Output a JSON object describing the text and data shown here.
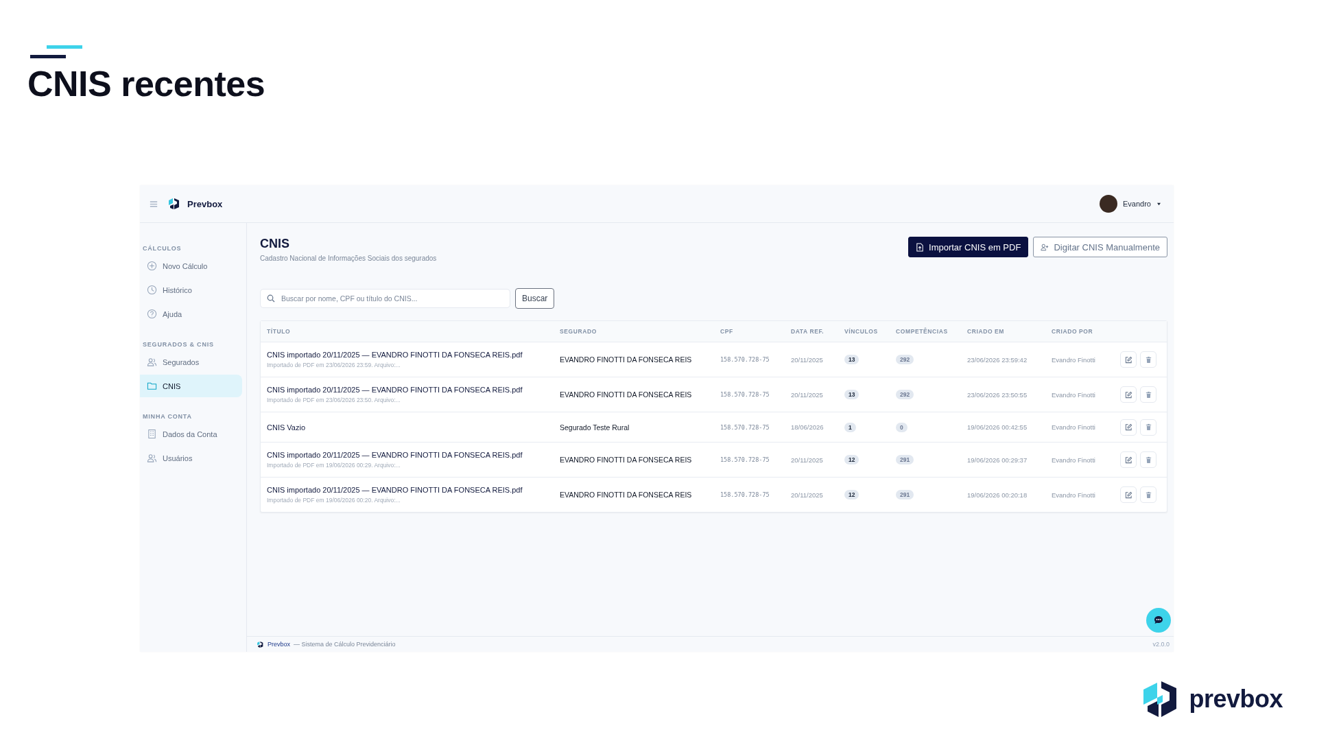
{
  "slide": {
    "title": "CNIS recentes",
    "logo": "prevbox"
  },
  "app": {
    "brand": "Prevbox",
    "user": "Evandro",
    "sidebar": [
      {
        "heading": "CÁLCULOS",
        "items": [
          {
            "label": "Novo Cálculo",
            "selected": false
          },
          {
            "label": "Histórico",
            "selected": false
          },
          {
            "label": "Ajuda",
            "selected": false
          }
        ]
      },
      {
        "heading": "SEGURADOS & CNIS",
        "items": [
          {
            "label": "Segurados",
            "selected": false
          },
          {
            "label": "CNIS",
            "selected": true
          }
        ]
      },
      {
        "heading": "MINHA CONTA",
        "items": [
          {
            "label": "Dados da Conta",
            "selected": false
          },
          {
            "label": "Usuários",
            "selected": false
          }
        ]
      }
    ],
    "page": {
      "title": "CNIS",
      "subtitle": "Cadastro Nacional de Informações Sociais dos segurados",
      "buttons": [
        {
          "label": "Importar CNIS em PDF",
          "kind": "primary"
        },
        {
          "label": "Digitar CNIS Manualmente",
          "kind": "outline"
        }
      ],
      "search": {
        "placeholder": "Buscar por nome, CPF ou título do CNIS...",
        "button": "Buscar"
      },
      "table": {
        "columns": [
          "TÍTULO",
          "SEGURADO",
          "CPF",
          "DATA REF.",
          "VÍNCULOS",
          "COMPETÊNCIAS",
          "CRIADO EM",
          "CRIADO POR"
        ],
        "rows": [
          {
            "title": "CNIS importado 20/11/2025 — EVANDRO FINOTTI DA FONSECA REIS.pdf",
            "note": "Importado de PDF em 23/06/2026 23:59. Arquivo:...",
            "insured": "EVANDRO FINOTTI DA FONSECA REIS",
            "cpf": "158.570.728-75",
            "ref_date": "20/11/2025",
            "links": "13",
            "periods": "292",
            "created_at": "23/06/2026 23:59:42",
            "created_by": "Evandro Finotti"
          },
          {
            "title": "CNIS importado 20/11/2025 — EVANDRO FINOTTI DA FONSECA REIS.pdf",
            "note": "Importado de PDF em 23/06/2026 23:50. Arquivo:...",
            "insured": "EVANDRO FINOTTI DA FONSECA REIS",
            "cpf": "158.570.728-75",
            "ref_date": "20/11/2025",
            "links": "13",
            "periods": "292",
            "created_at": "23/06/2026 23:50:55",
            "created_by": "Evandro Finotti"
          },
          {
            "title": "CNIS Vazio",
            "insured": "Segurado Teste Rural",
            "cpf": "158.570.728-75",
            "ref_date": "18/06/2026",
            "links": "1",
            "periods": "0",
            "created_at": "19/06/2026 00:42:55",
            "created_by": "Evandro Finotti"
          },
          {
            "title": "CNIS importado 20/11/2025 — EVANDRO FINOTTI DA FONSECA REIS.pdf",
            "note": "Importado de PDF em 19/06/2026 00:29. Arquivo:...",
            "insured": "EVANDRO FINOTTI DA FONSECA REIS",
            "cpf": "158.570.728-75",
            "ref_date": "20/11/2025",
            "links": "12",
            "periods": "291",
            "created_at": "19/06/2026 00:29:37",
            "created_by": "Evandro Finotti"
          },
          {
            "title": "CNIS importado 20/11/2025 — EVANDRO FINOTTI DA FONSECA REIS.pdf",
            "note": "Importado de PDF em 19/06/2026 00:20. Arquivo:...",
            "insured": "EVANDRO FINOTTI DA FONSECA REIS",
            "cpf": "158.570.728-75",
            "ref_date": "20/11/2025",
            "links": "12",
            "periods": "291",
            "created_at": "19/06/2026 00:20:18",
            "created_by": "Evandro Finotti"
          }
        ]
      }
    },
    "footer": {
      "brand": "Prevbox",
      "text": "— Sistema de Cálculo Previdenciário",
      "version": "v2.0.0"
    }
  }
}
